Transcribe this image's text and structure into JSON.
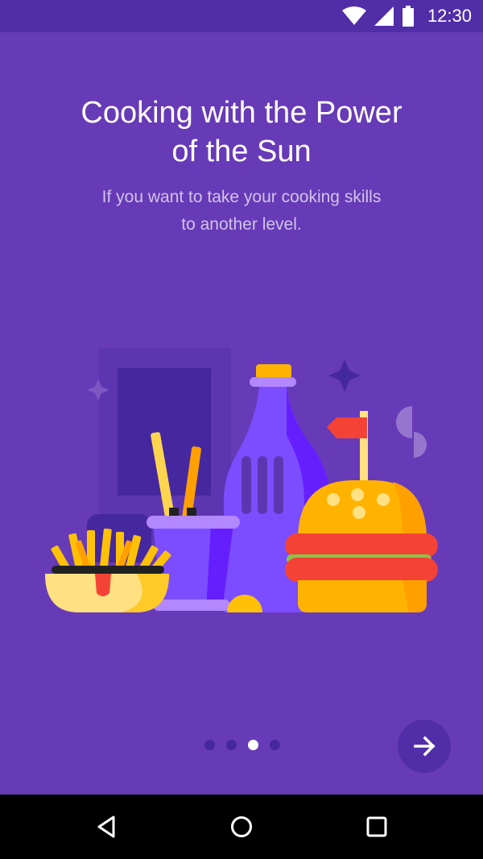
{
  "status_bar": {
    "time": "12:30",
    "icons": [
      "wifi-icon",
      "signal-icon",
      "battery-icon"
    ]
  },
  "onboarding": {
    "title_line1": "Cooking with the Power",
    "title_line2": "of the Sun",
    "subtitle_line1": "If you want to take your cooking skills",
    "subtitle_line2": "to another level.",
    "illustration_icon": "food-illustration",
    "page_count": 4,
    "current_page": 3
  },
  "next_button": {
    "icon": "arrow-right-icon"
  },
  "nav_bar": {
    "icons": [
      "back-icon",
      "home-icon",
      "recents-icon"
    ]
  },
  "colors": {
    "background": "#673AB7",
    "status_bar": "#512DA8",
    "subtitle": "#D1C4E9",
    "dot_inactive": "#4527A0",
    "dot_active": "#FFFFFF"
  }
}
